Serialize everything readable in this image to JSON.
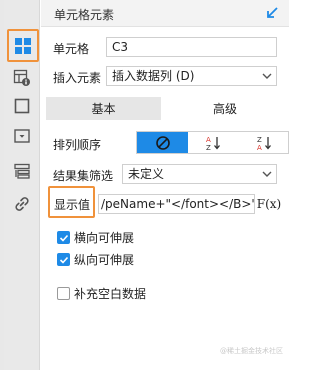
{
  "panel": {
    "title": "单元格元素"
  },
  "icons": {
    "sidebar": [
      "cell-element-icon",
      "cell-attribute-icon",
      "border-style-icon",
      "widget-icon",
      "form-icon",
      "hyperlink-icon"
    ],
    "header": "collapse-arrow-icon"
  },
  "cell": {
    "label": "单元格",
    "value": "C3"
  },
  "insert": {
    "label": "插入元素",
    "value": "插入数据列 (D)"
  },
  "tabs": [
    {
      "label": "基本",
      "selected": true
    },
    {
      "label": "高级",
      "selected": false
    }
  ],
  "sort": {
    "label": "排列顺序",
    "options": [
      "none",
      "ascending",
      "descending"
    ],
    "selected": "none"
  },
  "filter": {
    "label": "结果集筛选",
    "value": "未定义"
  },
  "display_value": {
    "label": "显示值",
    "value": "/peName+\"</font></B>\"))"
  },
  "fx_button": "F(x)",
  "options": [
    {
      "label": "横向可伸展",
      "checked": true
    },
    {
      "label": "纵向可伸展",
      "checked": true
    },
    {
      "label": "补充空白数据",
      "checked": false
    }
  ],
  "watermark": "@稀土掘金技术社区",
  "colors": {
    "accent": "#1e8ae6",
    "highlight": "#f0923b"
  }
}
